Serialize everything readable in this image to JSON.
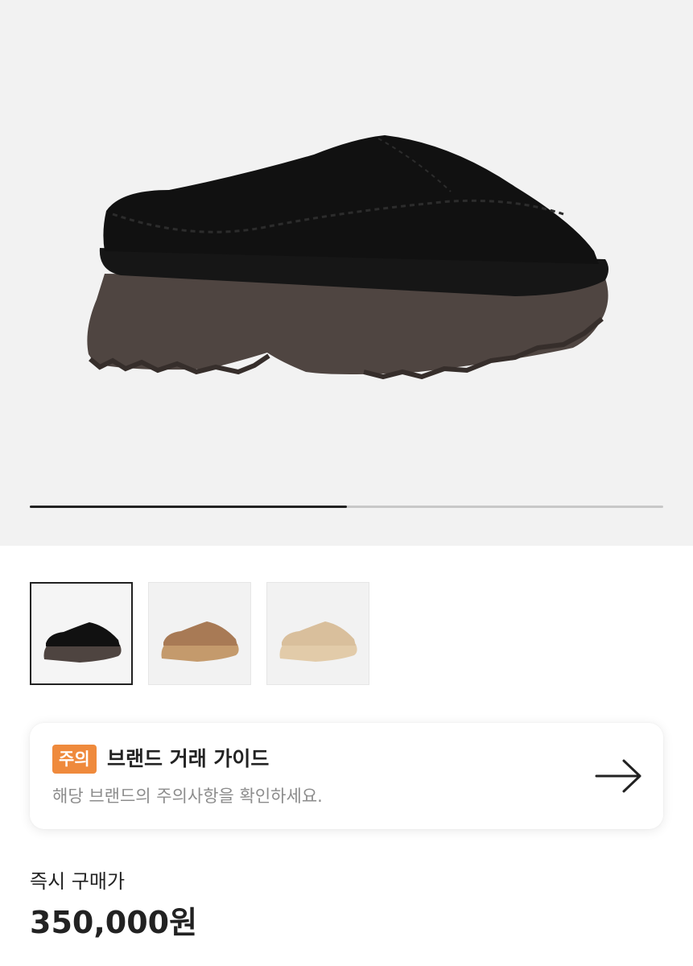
{
  "gallery": {
    "progress": 0.5,
    "image_count": 3,
    "selected_index": 0,
    "thumbnails": [
      {
        "color_name": "black",
        "upper": "#111111",
        "sole": "#4e4440"
      },
      {
        "color_name": "chestnut",
        "upper": "#a87a55",
        "sole": "#c49a6c"
      },
      {
        "color_name": "sand",
        "upper": "#d9bf9c",
        "sole": "#e2cba9"
      }
    ]
  },
  "guide": {
    "badge": "주의",
    "title": "브랜드 거래 가이드",
    "subtitle": "해당 브랜드의 주의사항을 확인하세요.",
    "badge_color": "#ef8a3c",
    "icon": "arrow-right-icon"
  },
  "price": {
    "label": "즉시 구매가",
    "value": "350,000원"
  }
}
